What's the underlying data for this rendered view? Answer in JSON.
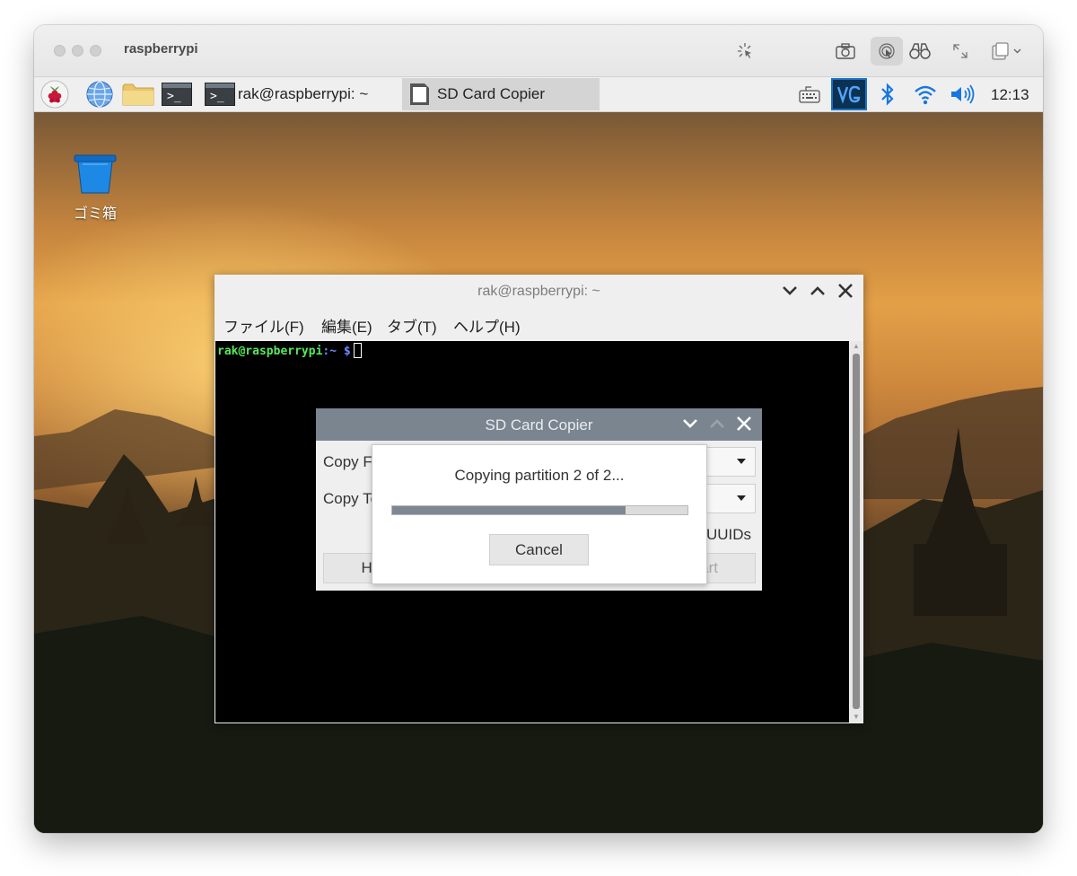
{
  "mac": {
    "title": "raspberrypi",
    "toolbar_icons": [
      "pointer-icon",
      "camera-icon",
      "touch-icon",
      "binoculars-icon",
      "expand-icon",
      "clipboard-icon"
    ]
  },
  "taskbar": {
    "launchers": [
      "raspberry-menu-icon",
      "globe-icon",
      "folder-icon",
      "terminal-icon"
    ],
    "tasks": [
      {
        "label": "rak@raspberrypi: ~",
        "icon": "terminal-icon",
        "active": false
      },
      {
        "label": "SD Card Copier",
        "icon": "sd-card-icon",
        "active": true
      }
    ],
    "tray_icons": [
      "keyboard-icon",
      "vnc-icon",
      "bluetooth-icon",
      "wifi-icon",
      "volume-icon"
    ],
    "clock": "12:13"
  },
  "desktop": {
    "trash_label": "ゴミ箱"
  },
  "terminal": {
    "title": "rak@raspberrypi: ~",
    "menus": [
      "ファイル(F)",
      "編集(E)",
      "タブ(T)",
      "ヘルプ(H)"
    ],
    "prompt_user": "rak@raspberrypi",
    "prompt_path": ":~ $"
  },
  "sd_copier": {
    "title": "SD Card Copier",
    "copy_from_label": "Copy From Device:",
    "copy_to_label": "Copy To Device:",
    "uuids_label": "New Partition UUIDs",
    "help_button": "Help",
    "start_button": "Start"
  },
  "progress_dialog": {
    "message": "Copying partition 2 of 2...",
    "progress_fraction": 0.79,
    "cancel_label": "Cancel"
  },
  "colors": {
    "prompt_green": "#57e85a",
    "prompt_blue": "#6b88ff",
    "dialog_titlebar": "#7b8590",
    "progress_fill": "#7d8893",
    "vnc_blue": "#1673c7",
    "tray_blue": "#1677e0"
  }
}
